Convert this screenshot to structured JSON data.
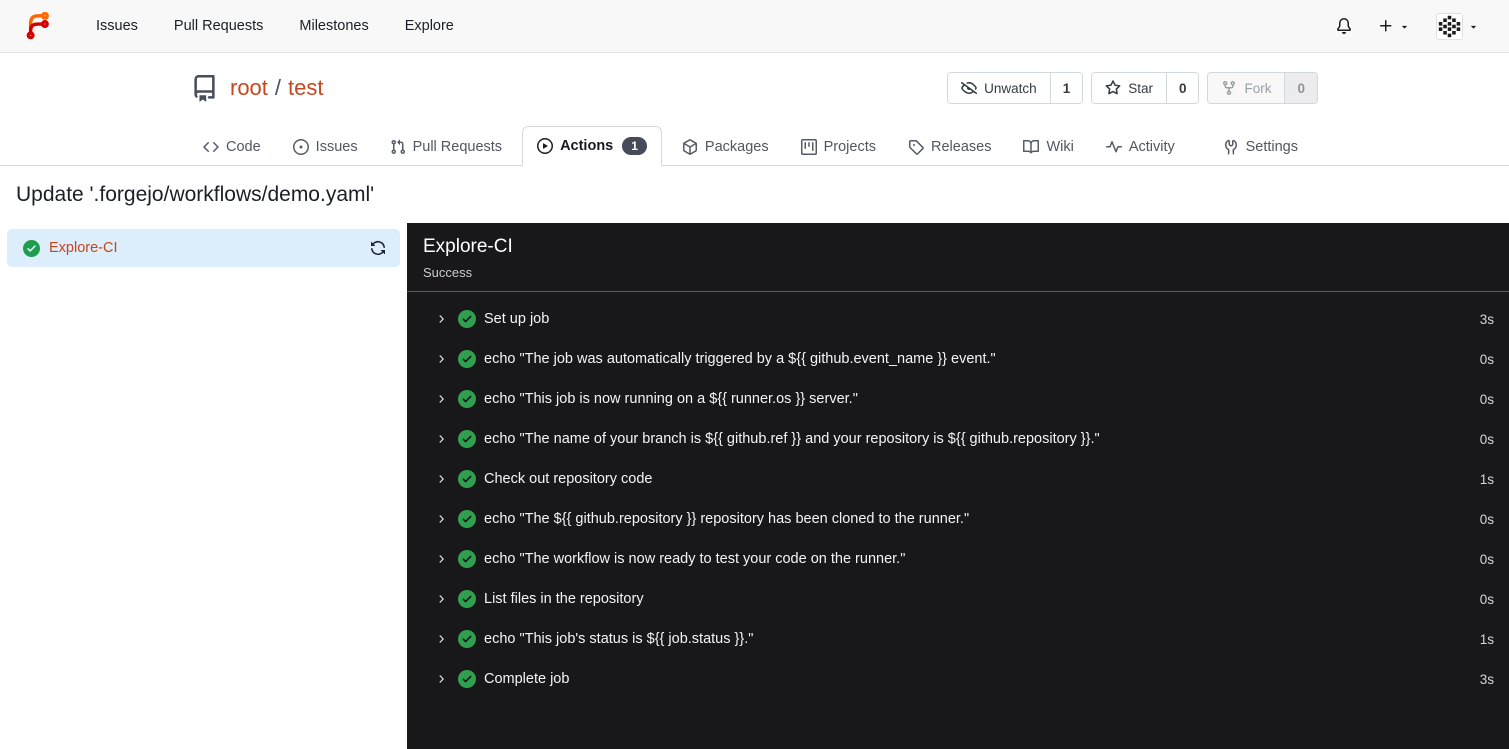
{
  "colors": {
    "accent_orange": "#c7461d",
    "success_green": "#2a9d4e",
    "panel_background": "#18181b",
    "active_tab_badge": "#454b59",
    "sidebar_item_background": "#dcedfb",
    "navbar_background": "#f8f8f8"
  },
  "navbar": {
    "links": [
      "Issues",
      "Pull Requests",
      "Milestones",
      "Explore"
    ],
    "icons": [
      "forgejo-logo",
      "bell-icon",
      "plus-icon",
      "avatar-identicon"
    ]
  },
  "repo": {
    "owner": "root",
    "separator": "/",
    "name": "test"
  },
  "repo_actions": {
    "unwatch": {
      "label": "Unwatch",
      "count": "1",
      "icon": "eye-closed-icon"
    },
    "star": {
      "label": "Star",
      "count": "0",
      "icon": "star-icon"
    },
    "fork": {
      "label": "Fork",
      "count": "0",
      "icon": "fork-icon",
      "disabled": true
    }
  },
  "tabs": [
    {
      "label": "Code",
      "icon": "code-icon"
    },
    {
      "label": "Issues",
      "icon": "issue-icon"
    },
    {
      "label": "Pull Requests",
      "icon": "pull-request-icon"
    },
    {
      "label": "Actions",
      "icon": "play-circle-icon",
      "badge": "1",
      "active": true
    },
    {
      "label": "Packages",
      "icon": "package-icon"
    },
    {
      "label": "Projects",
      "icon": "project-icon"
    },
    {
      "label": "Releases",
      "icon": "tag-icon"
    },
    {
      "label": "Wiki",
      "icon": "book-icon"
    },
    {
      "label": "Activity",
      "icon": "pulse-icon"
    },
    {
      "label": "Settings",
      "icon": "tools-icon"
    }
  ],
  "page": {
    "title": "Update '.forgejo/workflows/demo.yaml'"
  },
  "sidebar": {
    "job": {
      "name": "Explore-CI",
      "status_icon": "check-circle-icon",
      "action_icon": "sync-icon"
    }
  },
  "panel": {
    "title": "Explore-CI",
    "status": "Success",
    "steps": [
      {
        "name": "Set up job",
        "duration": "3s"
      },
      {
        "name": "echo \"The job was automatically triggered by a ${{ github.event_name }} event.\"",
        "duration": "0s"
      },
      {
        "name": "echo \"This job is now running on a ${{ runner.os }} server.\"",
        "duration": "0s"
      },
      {
        "name": "echo \"The name of your branch is ${{ github.ref }} and your repository is ${{ github.repository }}.\"",
        "duration": "0s"
      },
      {
        "name": "Check out repository code",
        "duration": "1s"
      },
      {
        "name": "echo \"The ${{ github.repository }} repository has been cloned to the runner.\"",
        "duration": "0s"
      },
      {
        "name": "echo \"The workflow is now ready to test your code on the runner.\"",
        "duration": "0s"
      },
      {
        "name": "List files in the repository",
        "duration": "0s"
      },
      {
        "name": "echo \"This job's status is ${{ job.status }}.\"",
        "duration": "1s"
      },
      {
        "name": "Complete job",
        "duration": "3s"
      }
    ]
  }
}
